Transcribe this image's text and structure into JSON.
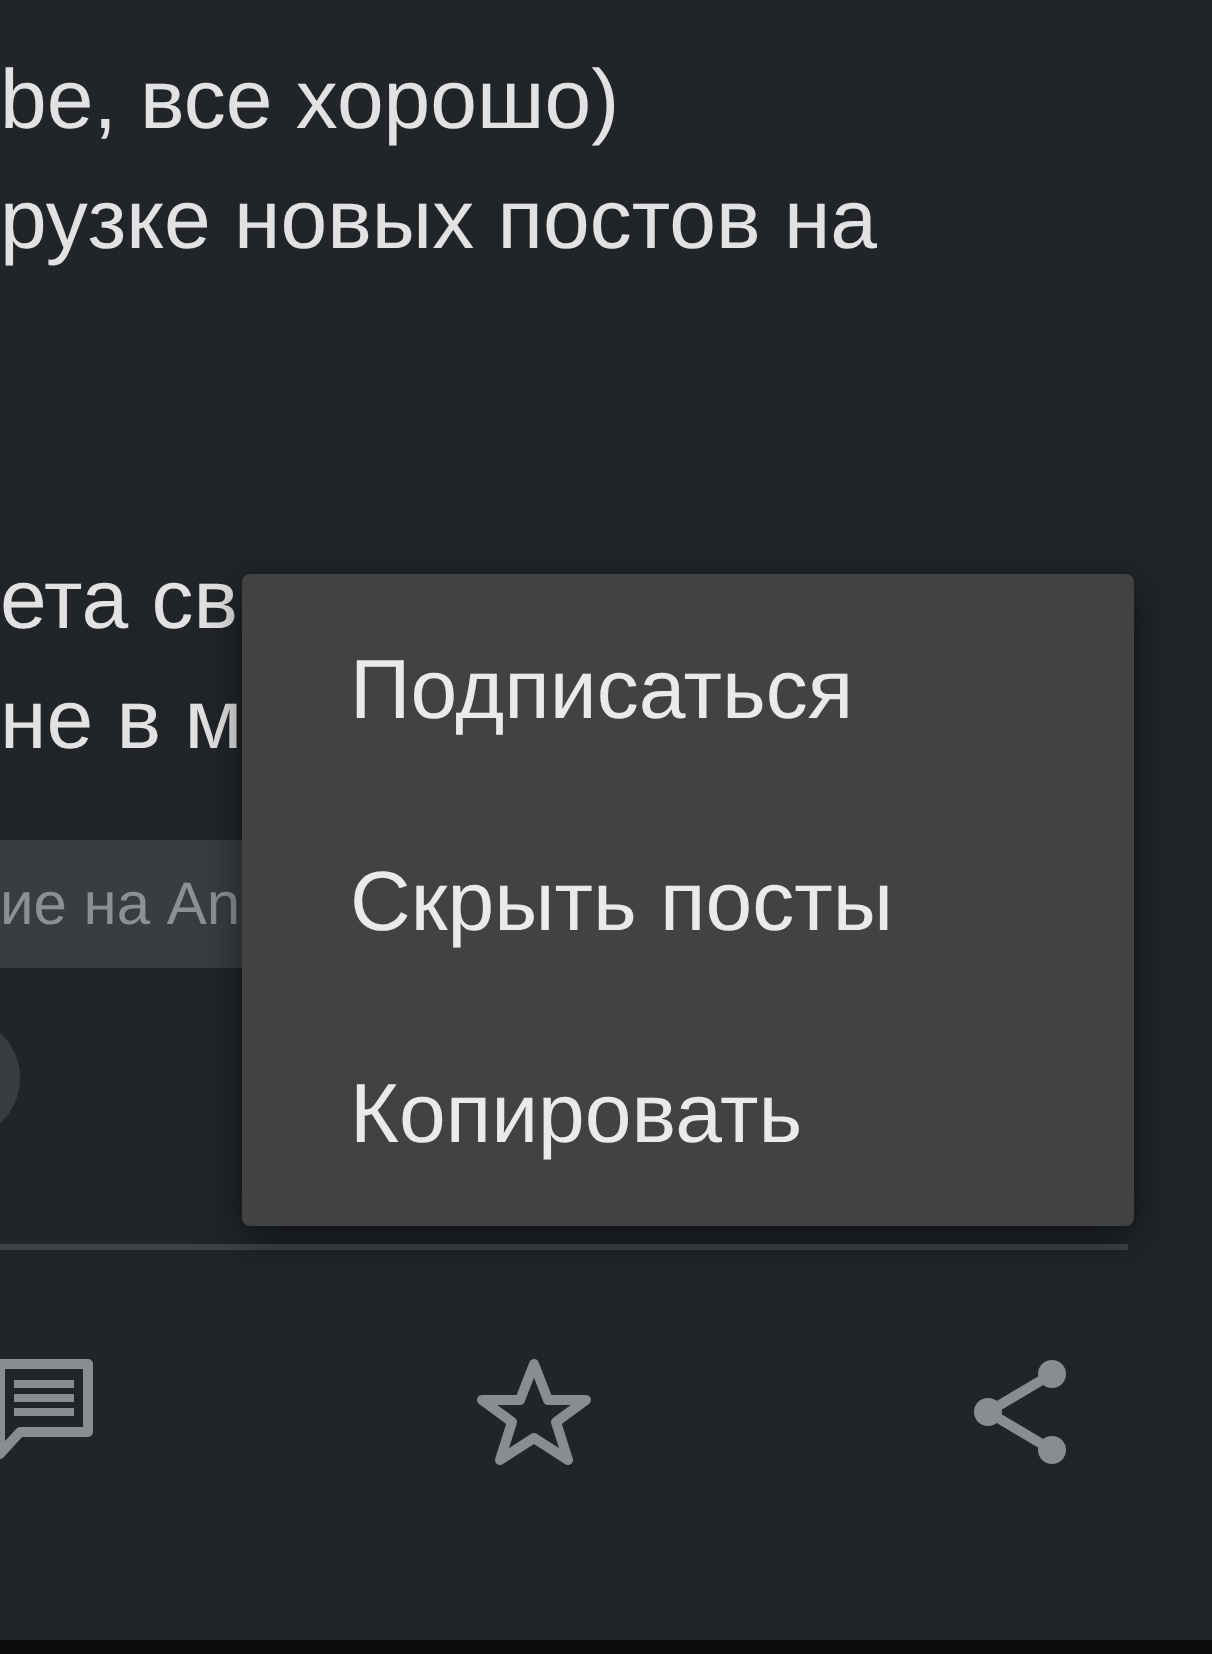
{
  "paragraphs": [
    [
      "be, все хорошо)",
      "рузке новых постов на"
    ],
    [
      "ета св",
      "не в м"
    ]
  ],
  "tag": "ие на An",
  "menu": {
    "items": [
      {
        "label": "Подписаться"
      },
      {
        "label": "Скрыть посты"
      },
      {
        "label": "Копировать"
      }
    ]
  },
  "actions": [
    {
      "kind": "comment"
    },
    {
      "kind": "star"
    },
    {
      "kind": "share"
    }
  ]
}
